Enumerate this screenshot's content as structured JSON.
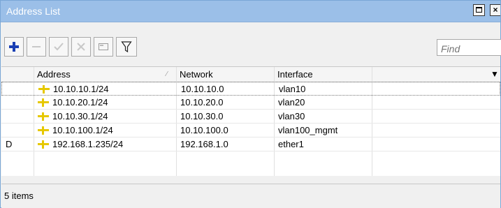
{
  "window": {
    "title": "Address List",
    "colors": {
      "titlebar": "#9bbfe8",
      "add_icon": "#1a3fb4",
      "address_icon": "#e6c800"
    }
  },
  "toolbar": {
    "buttons": [
      {
        "name": "add-button",
        "icon": "plus-icon"
      },
      {
        "name": "remove-button",
        "icon": "minus-icon"
      },
      {
        "name": "enable-button",
        "icon": "check-icon"
      },
      {
        "name": "disable-button",
        "icon": "x-icon"
      },
      {
        "name": "comment-button",
        "icon": "comment-icon"
      },
      {
        "name": "filter-button",
        "icon": "filter-icon"
      }
    ],
    "find_placeholder": "Find"
  },
  "table": {
    "columns": {
      "address": "Address",
      "network": "Network",
      "interface": "Interface"
    },
    "rows": [
      {
        "flag": "",
        "address": "10.10.10.1/24",
        "network": "10.10.10.0",
        "interface": "vlan10"
      },
      {
        "flag": "",
        "address": "10.10.20.1/24",
        "network": "10.10.20.0",
        "interface": "vlan20"
      },
      {
        "flag": "",
        "address": "10.10.30.1/24",
        "network": "10.10.30.0",
        "interface": "vlan30"
      },
      {
        "flag": "",
        "address": "10.10.100.1/24",
        "network": "10.10.100.0",
        "interface": "vlan100_mgmt"
      },
      {
        "flag": "D",
        "address": "192.168.1.235/24",
        "network": "192.168.1.0",
        "interface": "ether1"
      }
    ]
  },
  "status": {
    "count_text": "5 items"
  }
}
